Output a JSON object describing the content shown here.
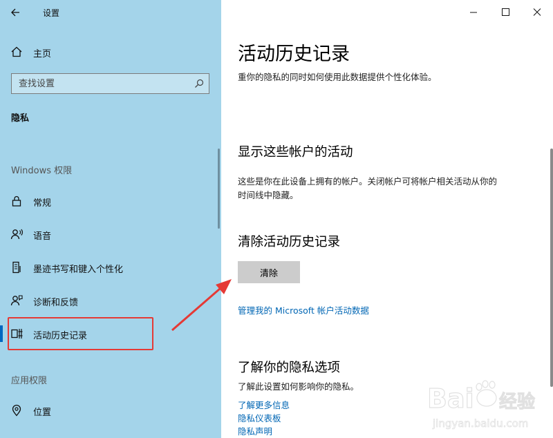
{
  "window": {
    "title": "设置"
  },
  "sidebar": {
    "home_label": "主页",
    "search_placeholder": "查找设置",
    "section_heading": "隐私",
    "group_windows": "Windows 权限",
    "items": [
      {
        "label": "常规",
        "icon": "lock-icon"
      },
      {
        "label": "语音",
        "icon": "speech-icon"
      },
      {
        "label": "墨迹书写和键入个性化",
        "icon": "ink-icon"
      },
      {
        "label": "诊断和反馈",
        "icon": "feedback-icon"
      },
      {
        "label": "活动历史记录",
        "icon": "activity-history-icon",
        "selected": true
      }
    ],
    "group_apps": "应用权限",
    "app_items": [
      {
        "label": "位置",
        "icon": "location-icon"
      }
    ]
  },
  "main": {
    "title": "活动历史记录",
    "intro_line2": "重你的隐私的同时如何使用此数据提供个性化体验。",
    "accounts_heading": "显示这些帐户的活动",
    "accounts_desc_line1": "这些是你在此设备上拥有的帐户。关闭帐户可将帐户相关活动从你的",
    "accounts_desc_line2": "时间线中隐藏。",
    "clear_heading": "清除活动历史记录",
    "clear_button": "清除",
    "manage_link": "管理我的 Microsoft 帐户活动数据",
    "privacy_heading": "了解你的隐私选项",
    "privacy_desc": "了解此设置如何影响你的隐私。",
    "links": [
      "了解更多信息",
      "隐私仪表板",
      "隐私声明"
    ]
  },
  "watermark": {
    "brand": "Bai",
    "brand_suffix": "经验",
    "url": "jingyan.baidu.com"
  },
  "colors": {
    "sidebar_bg": "#a4d4ea",
    "accent": "#0067c0",
    "link": "#0066b4",
    "annotation": "#e53935"
  }
}
